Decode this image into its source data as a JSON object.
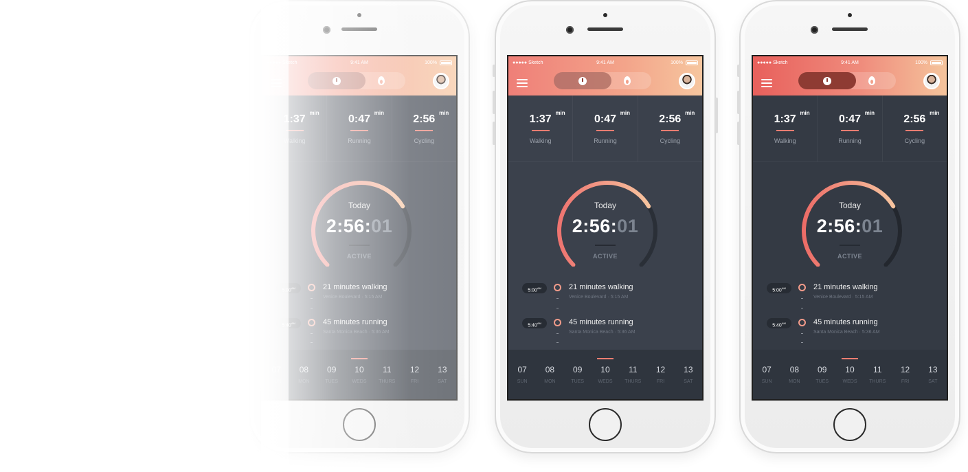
{
  "status": {
    "carrier": "●●●●● Sketch",
    "time": "9:41 AM",
    "battery": "100%"
  },
  "stats": [
    {
      "value": "1:37",
      "unit": "min",
      "label": "Walking"
    },
    {
      "value": "0:47",
      "unit": "min",
      "label": "Running"
    },
    {
      "value": "2:56",
      "unit": "min",
      "label": "Cycling"
    }
  ],
  "gauge": {
    "heading": "Today",
    "time_main": "2:56:",
    "time_secs": "01",
    "status": "ACTIVE",
    "progress": 0.72
  },
  "entries": [
    {
      "time": "5:00",
      "suffix": "AM",
      "title": "21 minutes walking",
      "place": "Venice Boulevard",
      "at": "5:15 AM"
    },
    {
      "time": "5:40",
      "suffix": "AM",
      "title": "45 minutes running",
      "place": "Santa Monica Beach",
      "at": "5:36 AM"
    }
  ],
  "days": [
    {
      "num": "07",
      "name": "SUN"
    },
    {
      "num": "08",
      "name": "MON"
    },
    {
      "num": "09",
      "name": "TUES"
    },
    {
      "num": "10",
      "name": "WEDS",
      "selected": true
    },
    {
      "num": "11",
      "name": "THURS"
    },
    {
      "num": "12",
      "name": "FRI"
    },
    {
      "num": "13",
      "name": "SAT"
    }
  ],
  "colors": {
    "accent": "#ef7d71",
    "header_start": "#ef7f78",
    "header_end": "#f6c69f",
    "screen": "#343a44"
  }
}
